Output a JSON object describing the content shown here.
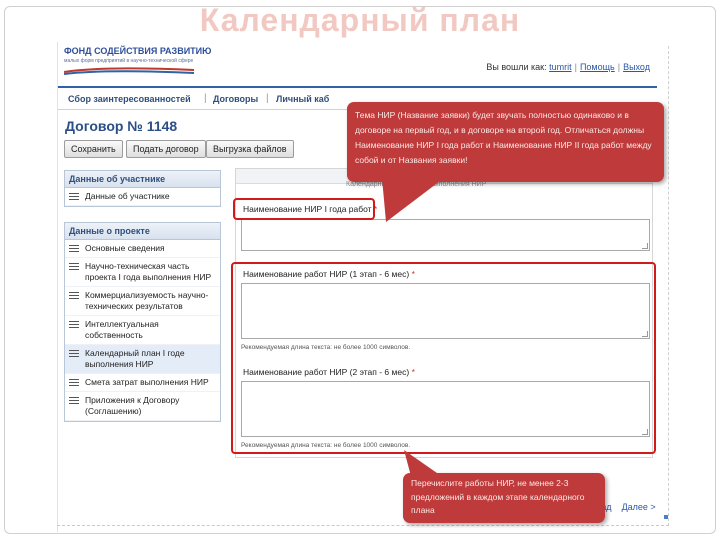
{
  "slide": {
    "title": "Календарный план"
  },
  "header": {
    "logo_title": "ФОНД СОДЕЙСТВИЯ РАЗВИТИЮ",
    "logo_subtitle": "малых форм предприятий в научно-технической сфере",
    "login_prefix": "Вы вошли как:",
    "login_user": "tumrit",
    "help": "Помощь",
    "logout": "Выход",
    "sep": "|"
  },
  "nav": {
    "items": [
      "Сбор заинтересованностей",
      "Договоры",
      "Личный каб"
    ],
    "sep": "|"
  },
  "contract": {
    "title": "Договор № 1148"
  },
  "toolbar": {
    "save": "Сохранить",
    "submit": "Подать договор",
    "export": "Выгрузка файлов"
  },
  "sidebar": {
    "participant": {
      "heading": "Данные об участнике",
      "items": [
        "Данные об участнике"
      ]
    },
    "project": {
      "heading": "Данные о проекте",
      "items": [
        "Основные сведения",
        "Научно-техническая часть проекта I года выполнения НИР",
        "Коммерциализуемость научно-технических результатов",
        "Интеллектуальная собственность",
        "Календарный план I годе выполнения НИР",
        "Смета затрат выполнения НИР",
        "Приложения к Договору (Соглашению)"
      ]
    }
  },
  "main": {
    "faded_label": "Календарный план I года выполнения НИР",
    "field1_label": "Наименование НИР I года работ",
    "field2_label": "Наименование работ НИР (1 этап - 6 мес)",
    "field3_label": "Наименование работ НИР (2 этап - 6 мес)",
    "required_mark": "*",
    "hint": "Рекомендуемая длина текста: не более 1000 символов."
  },
  "pager": {
    "back": "< Назад",
    "next": "Далее >"
  },
  "callouts": {
    "top": "Тема НИР (Название заявки) будет звучать полностью одинаково и в договоре на первый год, и в договоре на второй год. Отличаться должны Наименование НИР I года работ и Наименование НИР II года работ между собой и от Названия заявки!",
    "bottom": "Перечислите работы НИР, не менее 2-3 предложений в каждом этапе календарного плана"
  },
  "colors": {
    "callout_bg": "#bf3a3a",
    "highlight": "#d11a1a",
    "header_accent": "#2f63a6",
    "slide_title": "#f2c9c2"
  }
}
